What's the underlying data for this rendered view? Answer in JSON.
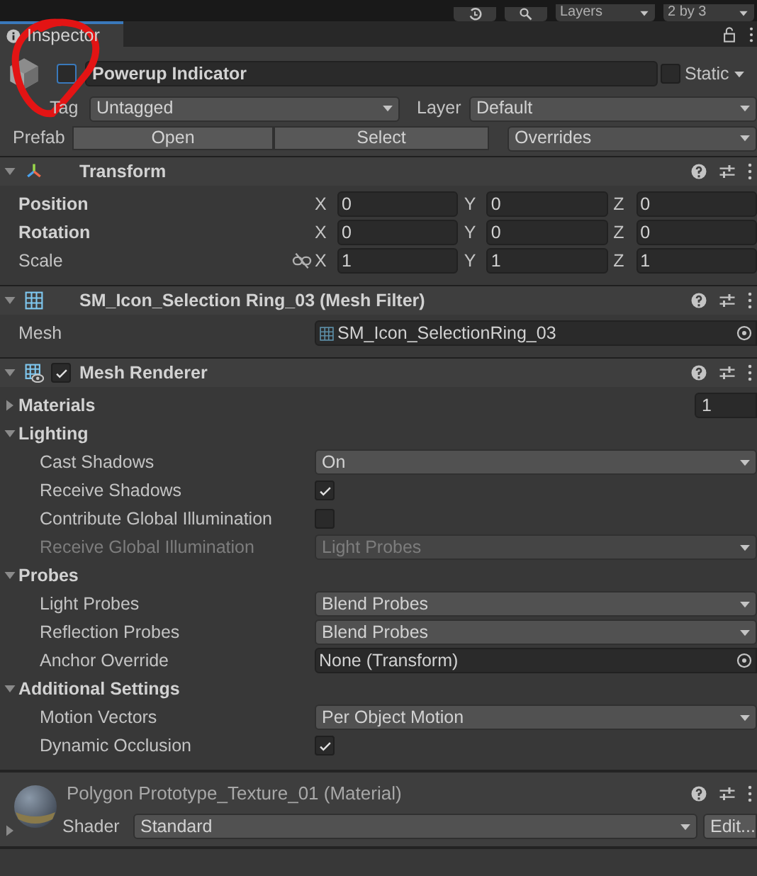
{
  "toolbar": {
    "layers_dropdown": "Layers",
    "layout_dropdown": "2 by 3"
  },
  "tab": {
    "label": "Inspector",
    "selected": true
  },
  "game_object": {
    "active": false,
    "name": "Powerup Indicator",
    "static": false,
    "static_label": "Static",
    "tag_label": "Tag",
    "tag": "Untagged",
    "layer_label": "Layer",
    "layer": "Default",
    "prefab_label": "Prefab",
    "prefab_buttons": [
      "Open",
      "Select"
    ],
    "overrides": "Overrides"
  },
  "components": [
    {
      "kind": "transform",
      "title": "Transform",
      "expanded": true,
      "rows": [
        {
          "kind": "vector3",
          "label": "Position",
          "overridden": true,
          "linked": false,
          "values": [
            {
              "axis": "X",
              "value": "0"
            },
            {
              "axis": "Y",
              "value": "0"
            },
            {
              "axis": "Z",
              "value": "0"
            }
          ]
        },
        {
          "kind": "vector3",
          "label": "Rotation",
          "overridden": true,
          "linked": false,
          "values": [
            {
              "axis": "X",
              "value": "0"
            },
            {
              "axis": "Y",
              "value": "0"
            },
            {
              "axis": "Z",
              "value": "0"
            }
          ]
        },
        {
          "kind": "vector3",
          "label": "Scale",
          "overridden": false,
          "linked": true,
          "values": [
            {
              "axis": "X",
              "value": "1"
            },
            {
              "axis": "Y",
              "value": "1"
            },
            {
              "axis": "Z",
              "value": "1"
            }
          ]
        }
      ]
    },
    {
      "kind": "mesh_filter",
      "title": "SM_Icon_Selection Ring_03 (Mesh Filter)",
      "expanded": true,
      "rows": [
        {
          "kind": "object",
          "label": "Mesh",
          "value": "SM_Icon_SelectionRing_03",
          "icon": true
        }
      ]
    },
    {
      "kind": "mesh_renderer",
      "title": "Mesh Renderer",
      "expanded": true,
      "enabled": true,
      "rows": [
        {
          "kind": "foldout",
          "label": "Materials",
          "expanded": false,
          "value": "1"
        },
        {
          "kind": "foldout",
          "label": "Lighting",
          "expanded": true,
          "children": [
            {
              "kind": "dropdown",
              "label": "Cast Shadows",
              "value": "On",
              "disabled": false
            },
            {
              "kind": "checkbox",
              "label": "Receive Shadows",
              "checked": true,
              "disabled": false
            },
            {
              "kind": "checkbox",
              "label": "Contribute Global Illumination",
              "checked": false,
              "disabled": false
            },
            {
              "kind": "dropdown",
              "label": "Receive Global Illumination",
              "value": "Light Probes",
              "disabled": true
            }
          ]
        },
        {
          "kind": "foldout",
          "label": "Probes",
          "expanded": true,
          "children": [
            {
              "kind": "dropdown",
              "label": "Light Probes",
              "value": "Blend Probes",
              "disabled": false
            },
            {
              "kind": "dropdown",
              "label": "Reflection Probes",
              "value": "Blend Probes",
              "disabled": false
            },
            {
              "kind": "object",
              "label": "Anchor Override",
              "value": "None (Transform)",
              "icon": false,
              "disabled": false
            }
          ]
        },
        {
          "kind": "foldout",
          "label": "Additional Settings",
          "expanded": true,
          "children": [
            {
              "kind": "dropdown",
              "label": "Motion Vectors",
              "value": "Per Object Motion",
              "disabled": false
            },
            {
              "kind": "checkbox",
              "label": "Dynamic Occlusion",
              "checked": true,
              "disabled": false
            }
          ]
        }
      ]
    },
    {
      "kind": "material",
      "title": "Polygon Prototype_Texture_01 (Material)",
      "expanded": false,
      "shader_label": "Shader",
      "shader": "Standard",
      "edit_button": "Edit..."
    }
  ]
}
